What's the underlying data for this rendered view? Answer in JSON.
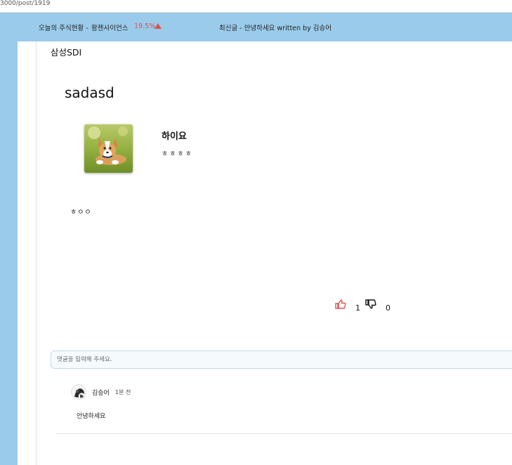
{
  "browser": {
    "url": "3000/post/1919"
  },
  "ticker": {
    "stock_prefix": "오늘의 주식현황 -",
    "stock_name": "팜젠사이언스",
    "stock_change": "19.5%",
    "latest_post": "최신글 - 안녕하세요 written by 김승어"
  },
  "post": {
    "category": "삼성SDI",
    "title": "sadasd",
    "author_name": "하이요",
    "author_sub": "ㅎㅎㅎㅎ",
    "body": "ㅎㅇㅇ",
    "likes": "1",
    "dislikes": "0"
  },
  "comment_form": {
    "placeholder": "댓글을 입력해 주세요."
  },
  "comments": [
    {
      "author": "김승어",
      "time": "1분 전",
      "text": "안녕하세요"
    }
  ],
  "colors": {
    "header_bg": "#9acbea",
    "accent_red": "#d9534f"
  }
}
